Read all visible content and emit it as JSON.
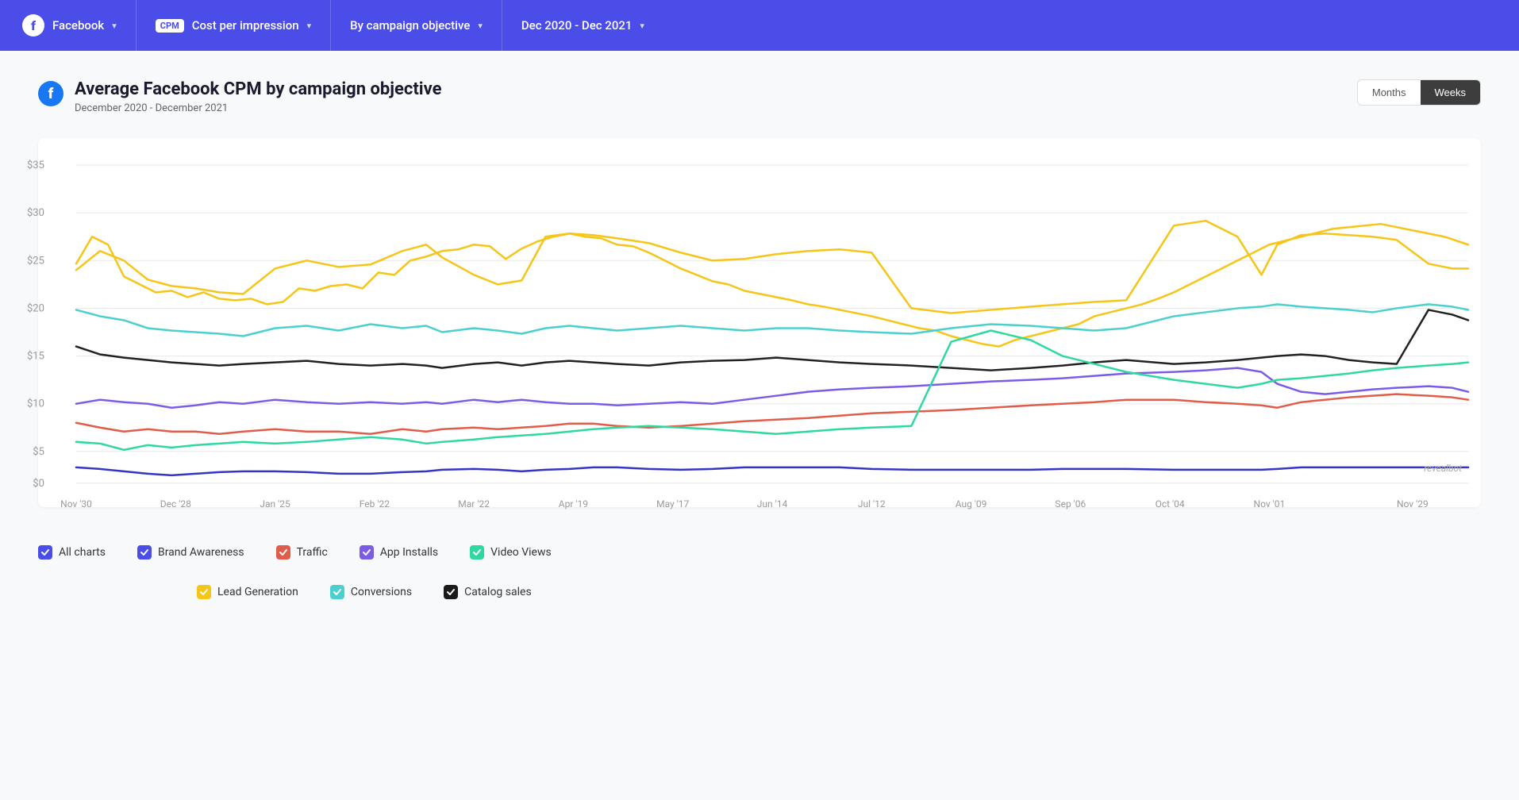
{
  "header": {
    "facebook_label": "Facebook",
    "cpm_badge": "CPM",
    "metric_label": "Cost per impression",
    "breakdown_label": "By campaign objective",
    "date_range_label": "Dec 2020 - Dec 2021",
    "chevron": "▾"
  },
  "chart": {
    "title": "Average Facebook CPM by campaign objective",
    "subtitle": "December 2020 - December 2021",
    "period_months": "Months",
    "period_weeks": "Weeks",
    "watermark": "revealbot",
    "y_labels": [
      "$35",
      "$30",
      "$25",
      "$20",
      "$15",
      "$10",
      "$5",
      "$0"
    ],
    "x_labels": [
      "Nov '30",
      "Dec '28",
      "Jan '25",
      "Feb '22",
      "Mar '22",
      "Apr '19",
      "May '17",
      "Jun '14",
      "Jul '12",
      "Aug '09",
      "Sep '06",
      "Oct '04",
      "Nov '01",
      "Nov '29"
    ]
  },
  "legend": {
    "items": [
      {
        "label": "All charts",
        "color": "#4a4de7",
        "checked": true
      },
      {
        "label": "Brand Awareness",
        "color": "#4a4de7",
        "checked": true
      },
      {
        "label": "Traffic",
        "color": "#e05c4b",
        "checked": true
      },
      {
        "label": "App Installs",
        "color": "#7b5ce7",
        "checked": true
      },
      {
        "label": "Video Views",
        "color": "#2ed8a0",
        "checked": true
      },
      {
        "label": "Lead Generation",
        "color": "#f5c518",
        "checked": true
      },
      {
        "label": "Conversions",
        "color": "#4bcfcf",
        "checked": true
      },
      {
        "label": "Catalog sales",
        "color": "#1a1a1a",
        "checked": true
      }
    ]
  }
}
